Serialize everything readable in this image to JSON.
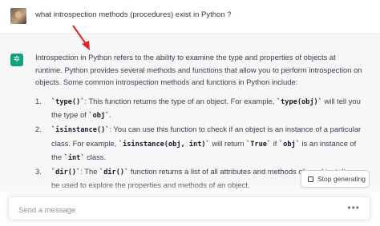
{
  "user_message": "what introspection methods (procedures) exist in Python ?",
  "assistant": {
    "icon": "chatgpt-logo-icon",
    "intro": "Introspection in Python refers to the ability to examine the type and properties of objects at runtime. Python provides several methods and functions that allow you to perform introspection on objects. Some common introspection methods and functions in Python include:",
    "items": [
      {
        "num": "1.",
        "parts": [
          {
            "t": "code",
            "v": "`type()`"
          },
          {
            "t": "text",
            "v": ": This function returns the type of an object. For example, "
          },
          {
            "t": "code",
            "v": "`type(obj)`"
          },
          {
            "t": "text",
            "v": " will tell you the type of "
          },
          {
            "t": "code",
            "v": "`obj`"
          },
          {
            "t": "text",
            "v": "."
          }
        ]
      },
      {
        "num": "2.",
        "parts": [
          {
            "t": "code",
            "v": "`isinstance()`"
          },
          {
            "t": "text",
            "v": ": You can use this function to check if an object is an instance of a particular class. For example, "
          },
          {
            "t": "code",
            "v": "`isinstance(obj, int)`"
          },
          {
            "t": "text",
            "v": " will return "
          },
          {
            "t": "code",
            "v": "`True`"
          },
          {
            "t": "text",
            "v": " if "
          },
          {
            "t": "code",
            "v": "`obj`"
          },
          {
            "t": "text",
            "v": " is an instance of the "
          },
          {
            "t": "code",
            "v": "`int`"
          },
          {
            "t": "text",
            "v": " class."
          }
        ]
      },
      {
        "num": "3.",
        "parts": [
          {
            "t": "code",
            "v": "`dir()`"
          },
          {
            "t": "text",
            "v": ": The "
          },
          {
            "t": "code",
            "v": "`dir()`"
          },
          {
            "t": "text",
            "v": " function returns a list of all attributes and methods of an object. It can be used to explore the properties and methods of an object."
          }
        ]
      }
    ]
  },
  "stop_button": {
    "label": "Stop generating",
    "icon": "stop-square-icon"
  },
  "composer": {
    "placeholder": "Send a message",
    "value": "",
    "icon": "more-dots-icon",
    "icon_glyph": "•••"
  },
  "annotation": {
    "icon": "red-arrow-icon",
    "color": "#e02424"
  },
  "colors": {
    "accent": "#10a37f",
    "assistant_bg": "#f7f7f8"
  }
}
